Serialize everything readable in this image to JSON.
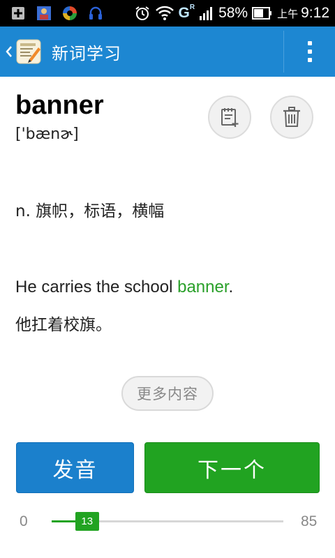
{
  "status_bar": {
    "network_label": "G",
    "roaming_label": "R",
    "battery": "58%",
    "ampm": "上午",
    "time": "9:12",
    "icons": [
      "sim-add-icon",
      "photo-icon",
      "sync-app-icon",
      "headset-icon",
      "alarm-icon",
      "wifi-icon",
      "signal-icon",
      "battery-icon"
    ]
  },
  "action_bar": {
    "title": "新词学习",
    "icons": [
      "back-chevron-icon",
      "wordbook-app-icon",
      "overflow-menu-icon"
    ]
  },
  "word": {
    "text": "banner",
    "phonetic": "['bænɚ]",
    "actions": [
      "add-to-list-icon",
      "trash-icon"
    ]
  },
  "definition": "n. 旗帜，标语，横幅",
  "example": {
    "before": "He carries the school ",
    "highlight": "banner",
    "after": ".",
    "translation": "他扛着校旗。"
  },
  "more_button": "更多内容",
  "buttons": {
    "pronounce": "发音",
    "next": "下一个"
  },
  "progress": {
    "min": "0",
    "max": "85",
    "current_label": "13",
    "current": 13,
    "total": 85
  },
  "colors": {
    "action_bar": "#1d87d2",
    "highlight": "#2aa02a",
    "primary_blue": "#1b80cc",
    "primary_green": "#21a321"
  }
}
